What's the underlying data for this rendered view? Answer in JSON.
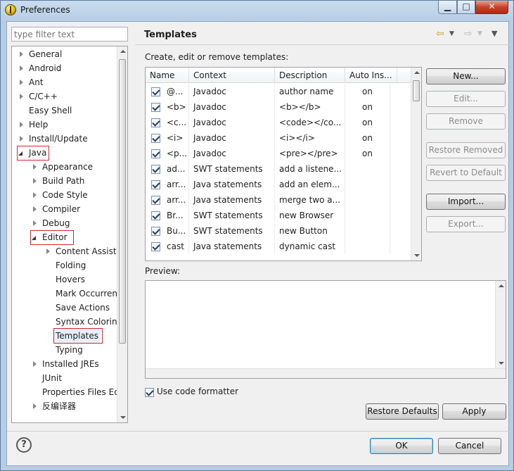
{
  "window": {
    "title": "Preferences",
    "minimize": "▁",
    "maximize": "□",
    "close": "✕"
  },
  "filter": {
    "placeholder": "type filter text"
  },
  "tree": {
    "items": [
      {
        "label": "General"
      },
      {
        "label": "Android"
      },
      {
        "label": "Ant"
      },
      {
        "label": "C/C++"
      },
      {
        "label": "Easy Shell"
      },
      {
        "label": "Help"
      },
      {
        "label": "Install/Update"
      },
      {
        "label": "Java"
      },
      {
        "label": "Appearance"
      },
      {
        "label": "Build Path"
      },
      {
        "label": "Code Style"
      },
      {
        "label": "Compiler"
      },
      {
        "label": "Debug"
      },
      {
        "label": "Editor"
      },
      {
        "label": "Content Assist"
      },
      {
        "label": "Folding"
      },
      {
        "label": "Hovers"
      },
      {
        "label": "Mark Occurrences"
      },
      {
        "label": "Save Actions"
      },
      {
        "label": "Syntax Coloring"
      },
      {
        "label": "Templates"
      },
      {
        "label": "Typing"
      },
      {
        "label": "Installed JREs"
      },
      {
        "label": "JUnit"
      },
      {
        "label": "Properties Files Editor"
      },
      {
        "label": "反编译器"
      }
    ]
  },
  "page": {
    "title": "Templates",
    "description": "Create, edit or remove templates:",
    "nav_back": "⇦",
    "nav_forward": "⇨",
    "nav_menu": "▼"
  },
  "table": {
    "headers": [
      "Name",
      "Context",
      "Description",
      "Auto Ins..."
    ],
    "rows": [
      {
        "name": "@...",
        "context": "Javadoc",
        "description": "author name",
        "auto": "on"
      },
      {
        "name": "<b>",
        "context": "Javadoc",
        "description": "<b></b>",
        "auto": "on"
      },
      {
        "name": "<c...",
        "context": "Javadoc",
        "description": "<code></co...",
        "auto": "on"
      },
      {
        "name": "<i>",
        "context": "Javadoc",
        "description": "<i></i>",
        "auto": "on"
      },
      {
        "name": "<p...",
        "context": "Javadoc",
        "description": "<pre></pre>",
        "auto": "on"
      },
      {
        "name": "ad...",
        "context": "SWT statements",
        "description": "add a listene...",
        "auto": ""
      },
      {
        "name": "arr...",
        "context": "Java statements",
        "description": "add an elem...",
        "auto": ""
      },
      {
        "name": "arr...",
        "context": "Java statements",
        "description": "merge two a...",
        "auto": ""
      },
      {
        "name": "Br...",
        "context": "SWT statements",
        "description": "new Browser",
        "auto": ""
      },
      {
        "name": "Bu...",
        "context": "SWT statements",
        "description": "new Button",
        "auto": ""
      },
      {
        "name": "cast",
        "context": "Java statements",
        "description": "dynamic cast",
        "auto": ""
      }
    ]
  },
  "buttons": {
    "new": "New...",
    "edit": "Edit...",
    "remove": "Remove",
    "restore_removed": "Restore Removed",
    "revert_default": "Revert to Default",
    "import": "Import...",
    "export": "Export...",
    "restore_defaults": "Restore Defaults",
    "apply": "Apply",
    "ok": "OK",
    "cancel": "Cancel"
  },
  "preview": {
    "label": "Preview:"
  },
  "formatter": {
    "label": "Use code formatter"
  },
  "help": {
    "glyph": "?"
  }
}
